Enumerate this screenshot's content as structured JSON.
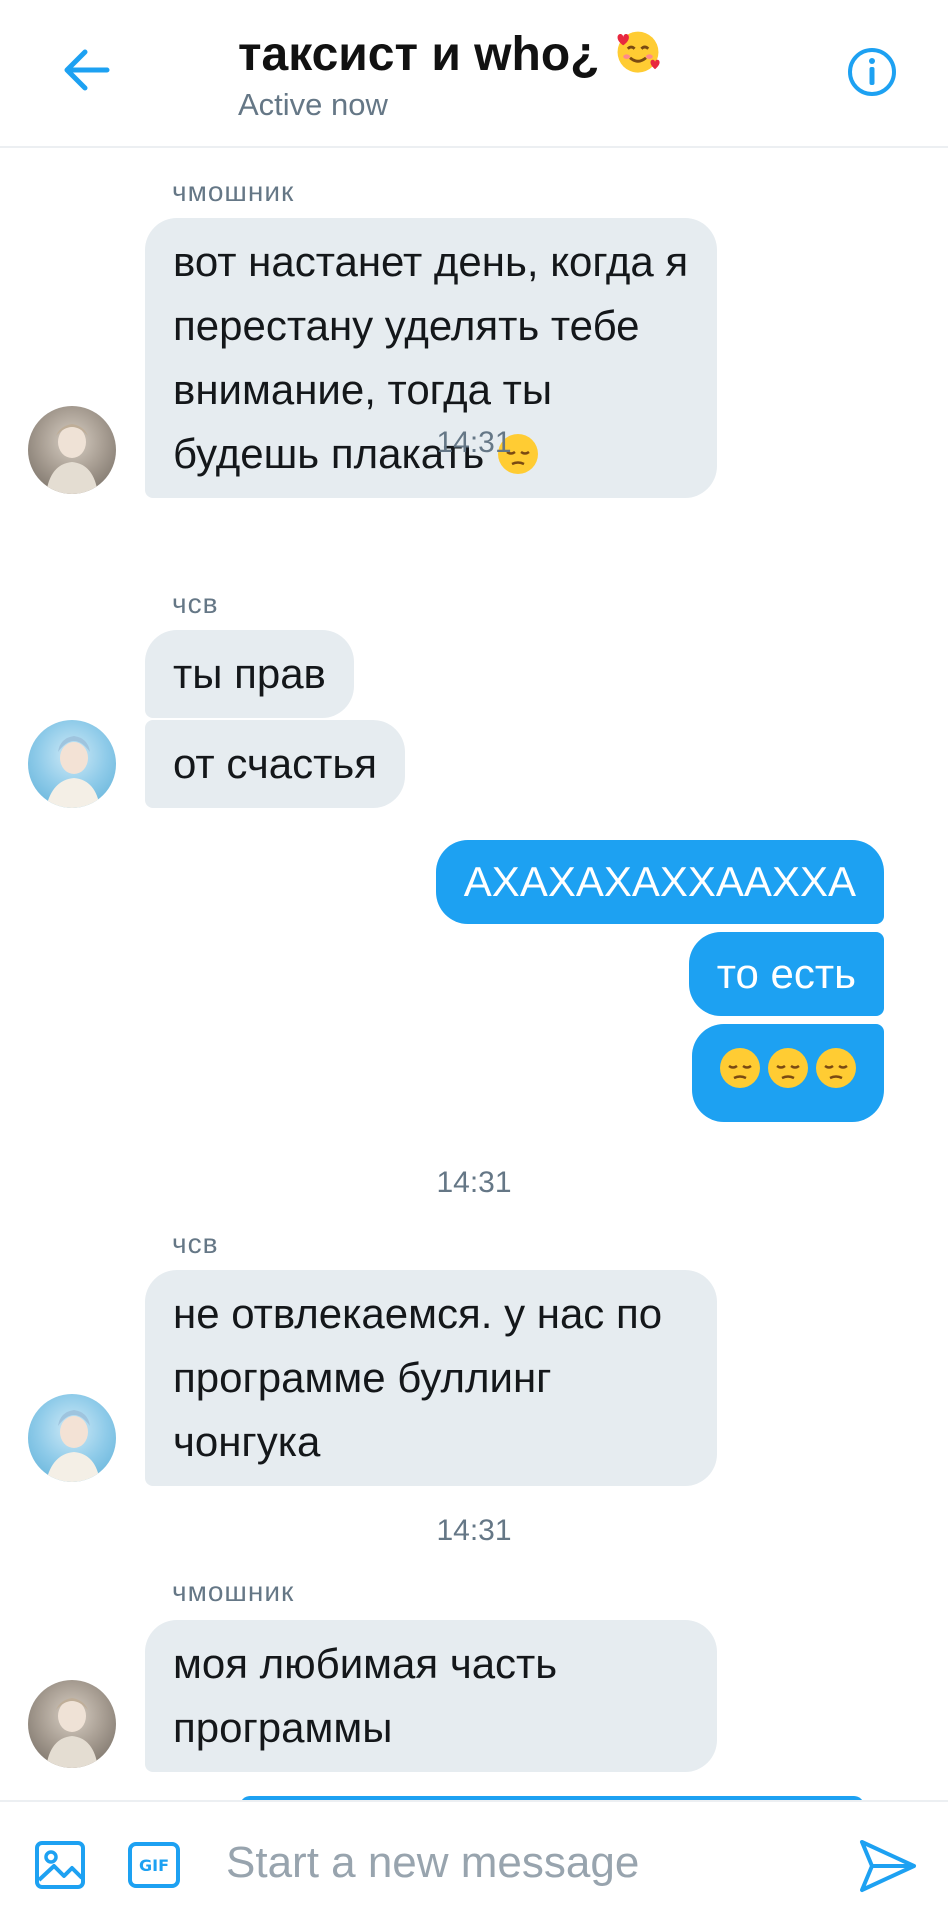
{
  "header": {
    "title": "таксист и who¿",
    "subtitle": "Active now",
    "back_icon": "arrow-left-icon",
    "info_icon": "info-icon",
    "accent": "#1da1f2"
  },
  "messages": [
    {
      "type": "in",
      "sender": "чмошник",
      "text": "вот настанет день, когда я перестану уделять тебе внимание, тогда ты будешь плакать",
      "emoji": "pensive-face-icon"
    },
    {
      "type": "time",
      "text": "14:31"
    },
    {
      "type": "in",
      "sender": "чсв",
      "text": "ты прав"
    },
    {
      "type": "in",
      "text": "от счастья"
    },
    {
      "type": "out",
      "text": "АХАХАХАХХААХХА"
    },
    {
      "type": "out",
      "text": "то есть"
    },
    {
      "type": "out",
      "emoji": "pensive-face-icon x3"
    },
    {
      "type": "time",
      "text": "14:31"
    },
    {
      "type": "in",
      "sender": "чсв",
      "text": "не отвлекаемся. у нас по программе буллинг чонгука"
    },
    {
      "type": "time",
      "text": "14:31"
    },
    {
      "type": "in",
      "sender": "чмошник",
      "text": "моя любимая часть программы"
    }
  ],
  "composer": {
    "placeholder": "Start a new message",
    "gif_label": "GIF",
    "media_icon": "image-icon",
    "send_icon": "send-icon"
  },
  "colors": {
    "incoming_bubble": "#e6ecf0",
    "outgoing_bubble": "#1da1f2",
    "muted_text": "#657786"
  }
}
